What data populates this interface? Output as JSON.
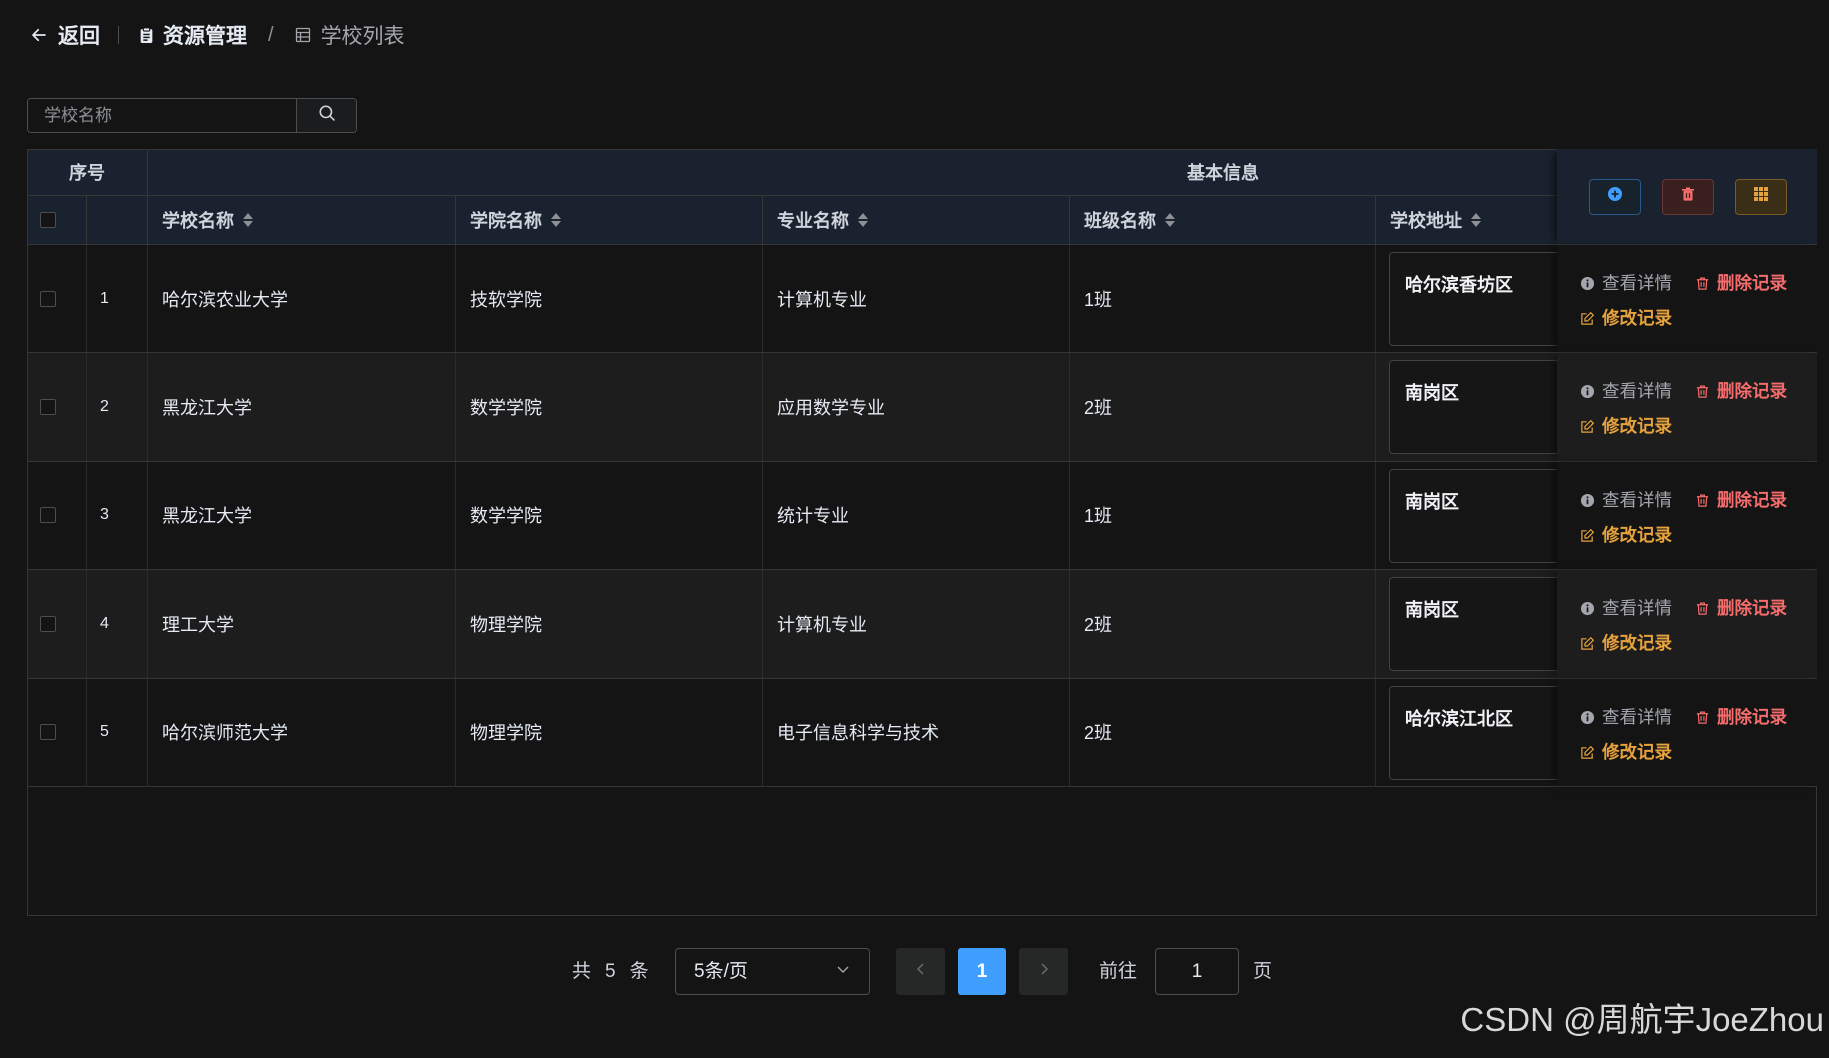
{
  "breadcrumb": {
    "back_label": "返回",
    "parent_label": "资源管理",
    "separator": "/",
    "current_label": "学校列表"
  },
  "search": {
    "placeholder": "学校名称",
    "value": ""
  },
  "table": {
    "group_headers": {
      "index": "序号",
      "basic_info": "基本信息"
    },
    "columns": [
      "学校名称",
      "学院名称",
      "专业名称",
      "班级名称",
      "学校地址"
    ],
    "rows": [
      {
        "index": "1",
        "school": "哈尔滨农业大学",
        "college": "技软学院",
        "major": "计算机专业",
        "class": "1班",
        "address": "哈尔滨香坊区"
      },
      {
        "index": "2",
        "school": "黑龙江大学",
        "college": "数学学院",
        "major": "应用数学专业",
        "class": "2班",
        "address": "南岗区"
      },
      {
        "index": "3",
        "school": "黑龙江大学",
        "college": "数学学院",
        "major": "统计专业",
        "class": "1班",
        "address": "南岗区"
      },
      {
        "index": "4",
        "school": "理工大学",
        "college": "物理学院",
        "major": "计算机专业",
        "class": "2班",
        "address": "南岗区"
      },
      {
        "index": "5",
        "school": "哈尔滨师范大学",
        "college": "物理学院",
        "major": "电子信息科学与技术",
        "class": "2班",
        "address": "哈尔滨江北区"
      }
    ],
    "actions": {
      "view": "查看详情",
      "delete": "删除记录",
      "edit": "修改记录"
    }
  },
  "pagination": {
    "total_prefix": "共",
    "total": "5",
    "total_suffix": "条",
    "page_size": "5条/页",
    "current_page": "1",
    "goto_label": "前往",
    "goto_value": "1",
    "page_suffix": "页"
  },
  "watermark": "CSDN @周航宇JoeZhou",
  "icons": {
    "back": "arrow-left-icon",
    "parent": "document-icon",
    "current": "table-icon",
    "search": "search-icon",
    "view": "info-icon",
    "delete": "trash-icon",
    "edit": "edit-icon",
    "toolbar_add": "plus-circle-icon",
    "toolbar_delete": "trash-icon",
    "toolbar_columns": "grid-icon"
  },
  "colors": {
    "primary": "#409eff",
    "danger": "#f56c6c",
    "warning": "#e6a23c",
    "muted": "#a3a6ad"
  }
}
